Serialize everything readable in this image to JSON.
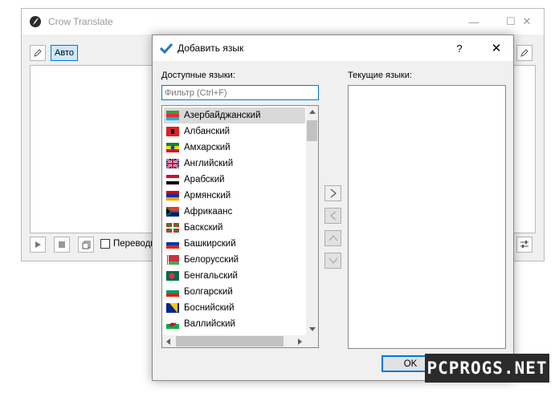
{
  "main_window": {
    "title": "Crow Translate",
    "source_lang_button": "Авто",
    "translate_checkbox_label": "Переводи"
  },
  "dialog": {
    "title": "Добавить язык",
    "help": "?",
    "available_label": "Доступные языки:",
    "current_label": "Текущие языки:",
    "filter_placeholder": "Фильтр (Ctrl+F)",
    "languages": [
      {
        "name": "Азербайджанский",
        "flag": "az",
        "selected": true
      },
      {
        "name": "Албанский",
        "flag": "al"
      },
      {
        "name": "Амхарский",
        "flag": "et"
      },
      {
        "name": "Английский",
        "flag": "gb"
      },
      {
        "name": "Арабский",
        "flag": "eg"
      },
      {
        "name": "Армянский",
        "flag": "am"
      },
      {
        "name": "Африкаанс",
        "flag": "za"
      },
      {
        "name": "Баскский",
        "flag": "eu"
      },
      {
        "name": "Башкирский",
        "flag": "ru"
      },
      {
        "name": "Белорусский",
        "flag": "by"
      },
      {
        "name": "Бенгальский",
        "flag": "bd"
      },
      {
        "name": "Болгарский",
        "flag": "bg"
      },
      {
        "name": "Боснийский",
        "flag": "ba"
      },
      {
        "name": "Валлийский",
        "flag": "wales"
      }
    ],
    "ok_label": "OK"
  },
  "watermark": "PCPROGS.NET",
  "colors": {
    "accent": "#0078d7",
    "selection": "#cce8ff"
  }
}
